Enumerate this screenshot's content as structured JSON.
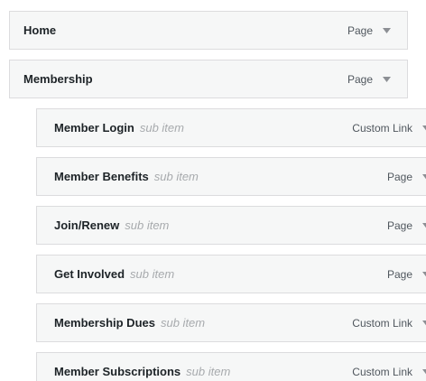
{
  "menu_items": [
    {
      "title": "Home",
      "type_label": "Page",
      "depth": 0
    },
    {
      "title": "Membership",
      "type_label": "Page",
      "depth": 0
    },
    {
      "title": "Member Login",
      "sub_label": "sub item",
      "type_label": "Custom Link",
      "depth": 1
    },
    {
      "title": "Member Benefits",
      "sub_label": "sub item",
      "type_label": "Page",
      "depth": 1
    },
    {
      "title": "Join/Renew",
      "sub_label": "sub item",
      "type_label": "Page",
      "depth": 1
    },
    {
      "title": "Get Involved",
      "sub_label": "sub item",
      "type_label": "Page",
      "depth": 1
    },
    {
      "title": "Membership Dues",
      "sub_label": "sub item",
      "type_label": "Custom Link",
      "depth": 1
    },
    {
      "title": "Member Subscriptions",
      "sub_label": "sub item",
      "type_label": "Custom Link",
      "depth": 1
    }
  ],
  "colors": {
    "item_background": "#f6f7f7",
    "item_border": "#dcdcde",
    "title_text": "#1d2327",
    "sub_label_text": "#a7aaad",
    "type_text": "#50575e",
    "arrow": "#8c8f94"
  },
  "icons": {
    "toggle": "arrow-down-icon"
  }
}
